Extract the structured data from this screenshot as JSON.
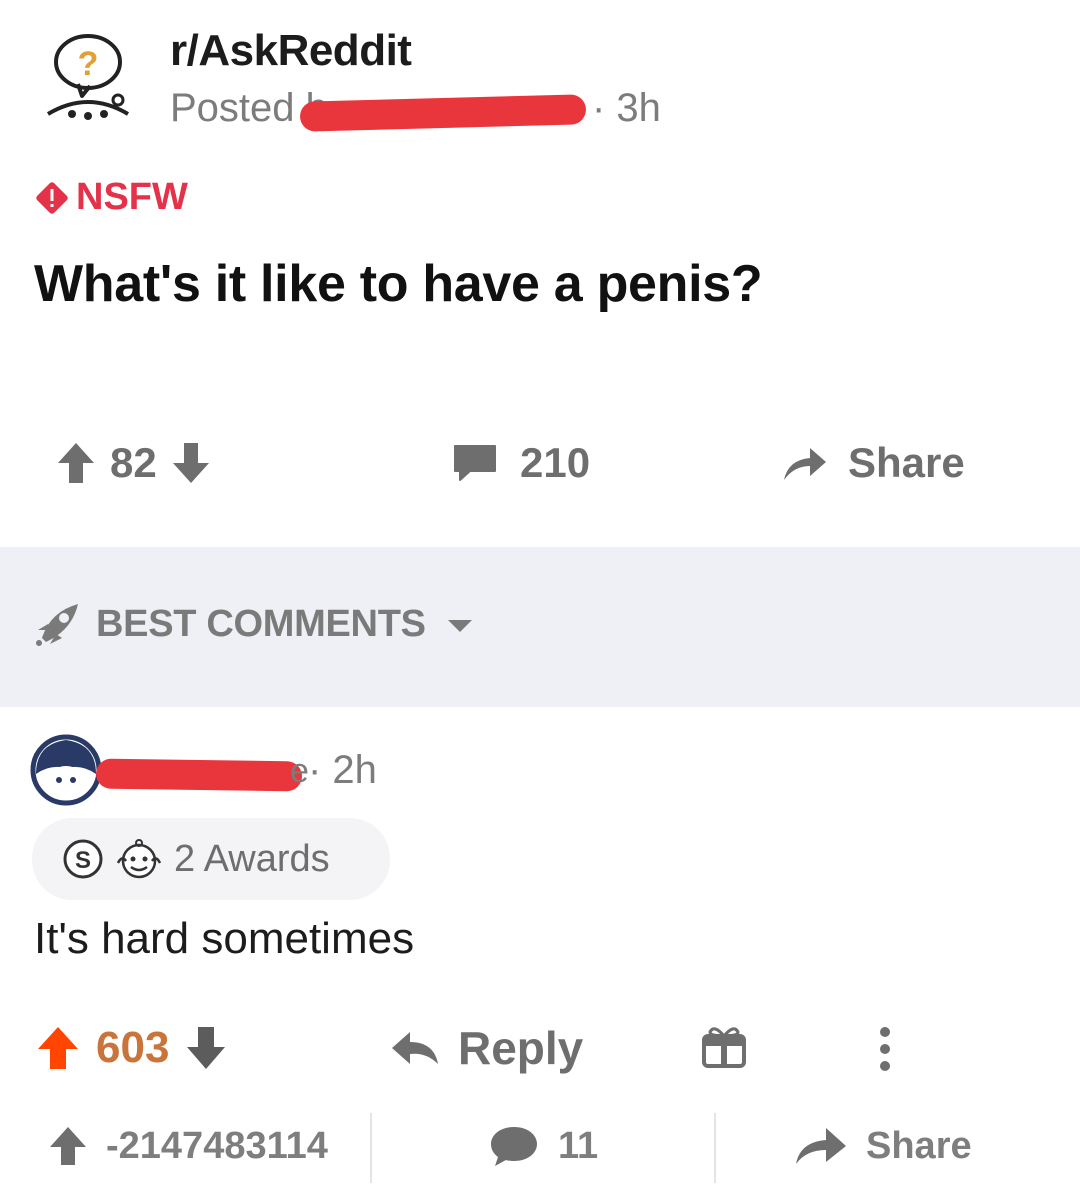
{
  "post": {
    "subreddit": "r/AskReddit",
    "posted_by_prefix": "Posted b",
    "post_time": "· 3h",
    "flair": "NSFW",
    "title": "What's it like to have a penis?",
    "score": "82",
    "comment_count": "210",
    "share_label": "Share"
  },
  "sort": {
    "label": "BEST COMMENTS"
  },
  "comment": {
    "username_tail": "e",
    "time": "· 2h",
    "awards_label": "2 Awards",
    "body": "It's hard sometimes",
    "score": "603",
    "reply_label": "Reply"
  },
  "bottom_bar": {
    "score": "-2147483114",
    "comments": "11",
    "share_label": "Share"
  },
  "colors": {
    "redaction": "#e8363c",
    "nsfw": "#e3324a",
    "upvoted": "#ff4500",
    "band": "#eef0f6"
  }
}
